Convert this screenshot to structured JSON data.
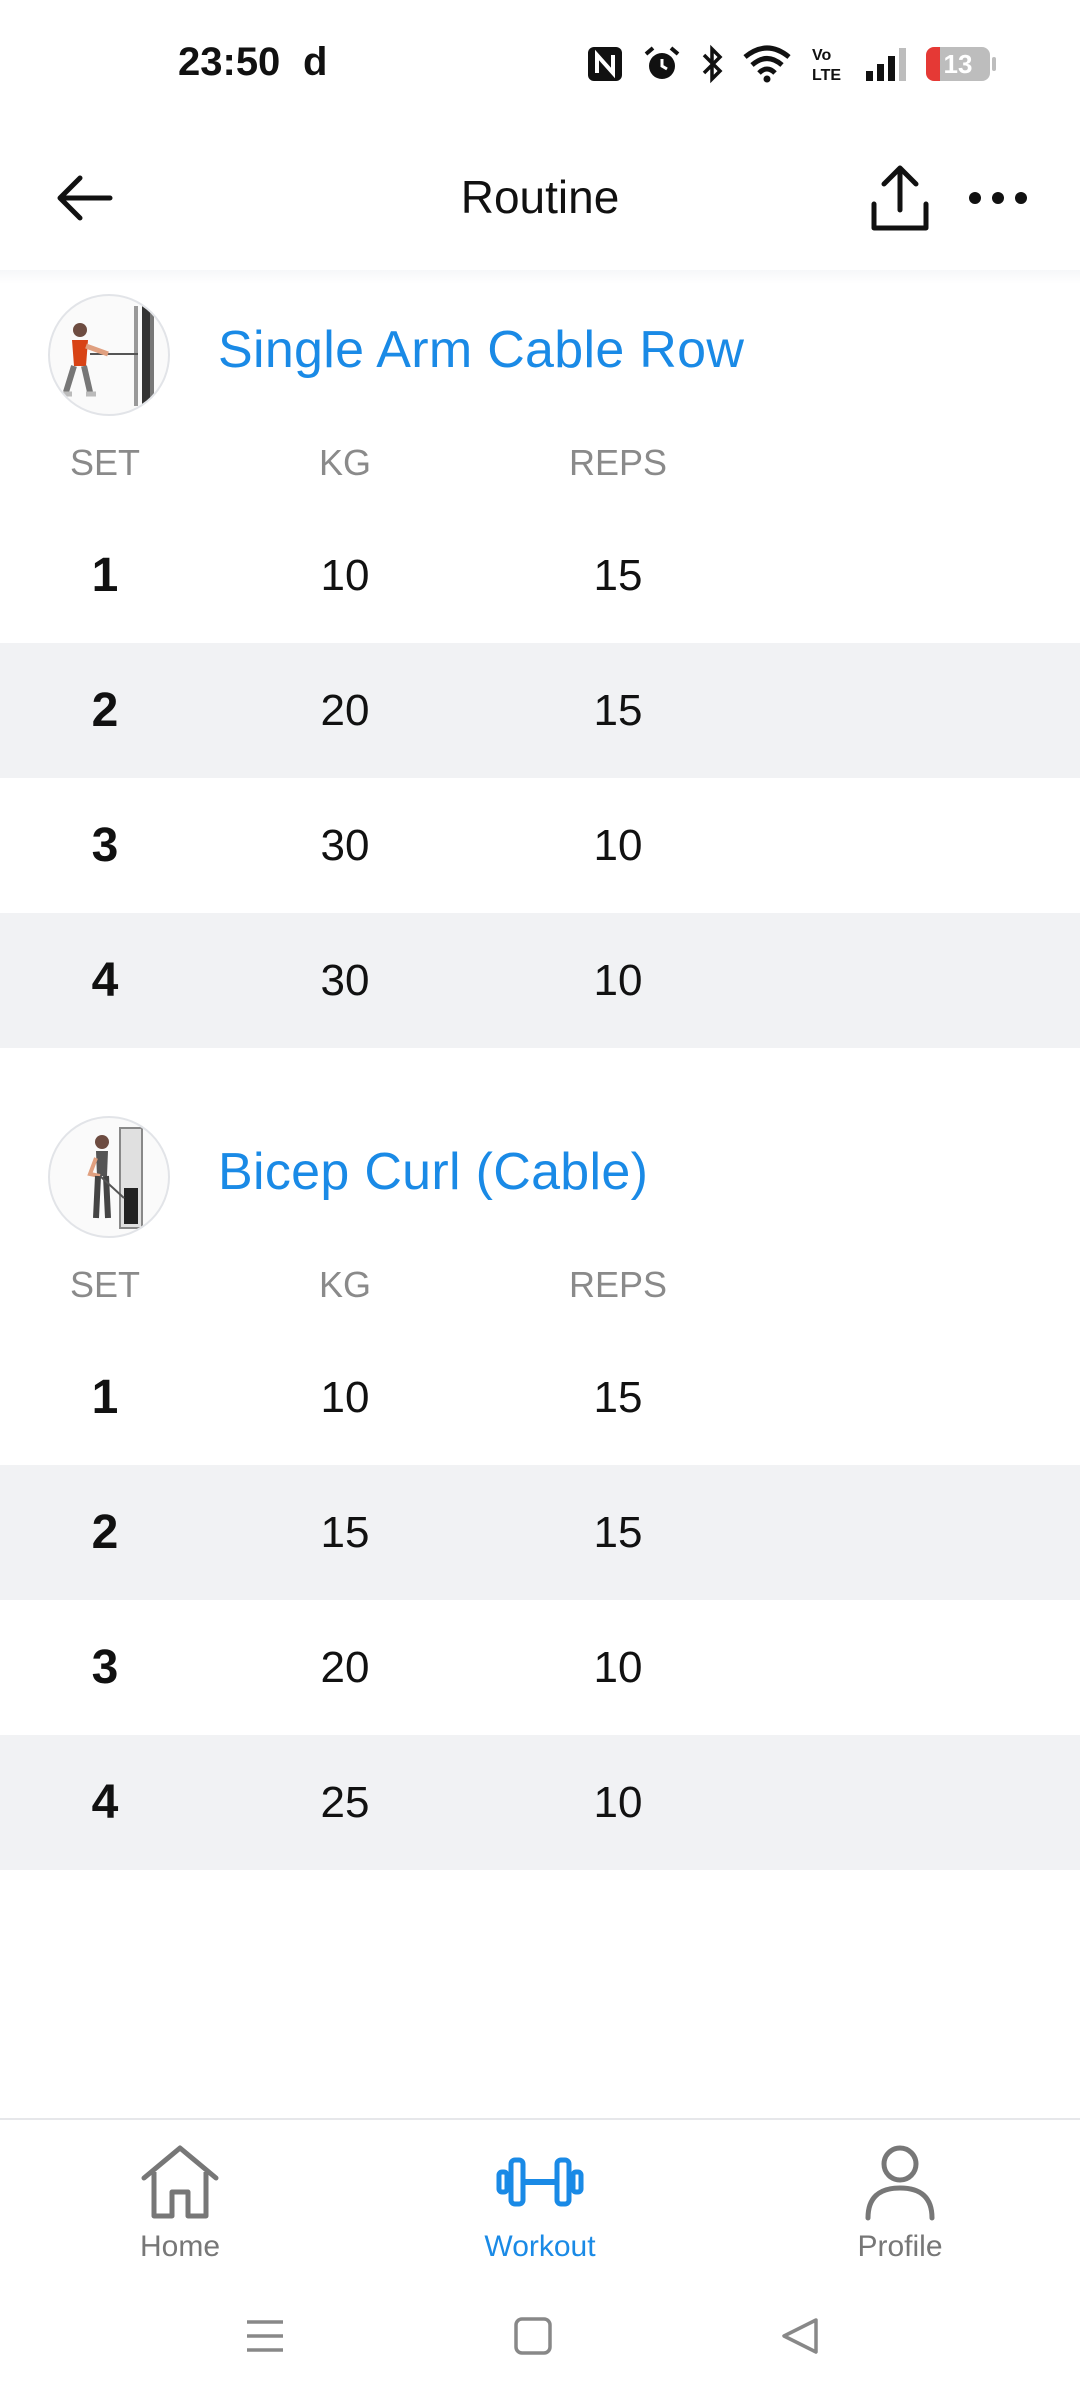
{
  "status_bar": {
    "time": "23:50",
    "extra": "d",
    "battery": "13",
    "icons": [
      "nfc-icon",
      "alarm-icon",
      "bluetooth-icon",
      "wifi-icon",
      "volte-icon",
      "signal-icon",
      "battery-icon"
    ]
  },
  "header": {
    "title": "Routine",
    "back_icon": "back-arrow-icon",
    "share_icon": "share-icon",
    "more_icon": "more-icon"
  },
  "columns": {
    "set": "SET",
    "kg": "KG",
    "reps": "REPS"
  },
  "exercises": [
    {
      "name": "Single Arm Cable Row",
      "sets": [
        {
          "set": "1",
          "kg": "10",
          "reps": "15"
        },
        {
          "set": "2",
          "kg": "20",
          "reps": "15"
        },
        {
          "set": "3",
          "kg": "30",
          "reps": "10"
        },
        {
          "set": "4",
          "kg": "30",
          "reps": "10"
        }
      ]
    },
    {
      "name": "Bicep Curl (Cable)",
      "sets": [
        {
          "set": "1",
          "kg": "10",
          "reps": "15"
        },
        {
          "set": "2",
          "kg": "15",
          "reps": "15"
        },
        {
          "set": "3",
          "kg": "20",
          "reps": "10"
        },
        {
          "set": "4",
          "kg": "25",
          "reps": "10"
        }
      ]
    }
  ],
  "bottom_nav": {
    "items": [
      {
        "label": "Home",
        "icon": "home-icon"
      },
      {
        "label": "Workout",
        "icon": "dumbbell-icon",
        "active": true
      },
      {
        "label": "Profile",
        "icon": "profile-icon"
      }
    ]
  },
  "colors": {
    "accent": "#1a8ae6",
    "row_shade": "#f1f2f4",
    "muted": "#8a8a8a"
  }
}
